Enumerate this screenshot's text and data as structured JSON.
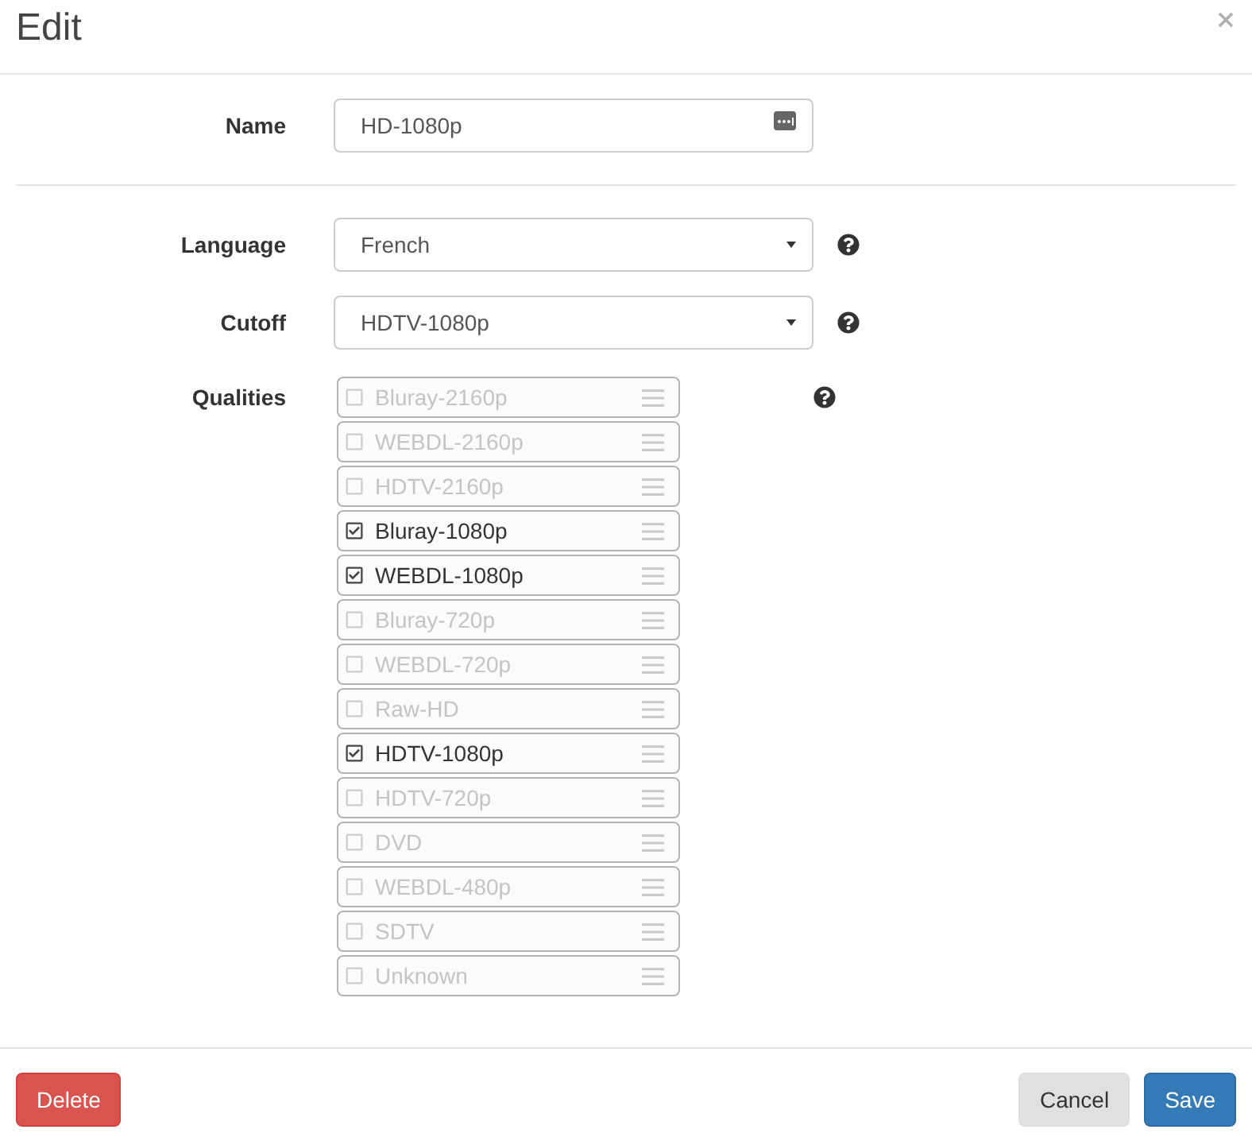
{
  "dialog": {
    "title": "Edit"
  },
  "form": {
    "name": {
      "label": "Name",
      "value": "HD-1080p"
    },
    "language": {
      "label": "Language",
      "value": "French"
    },
    "cutoff": {
      "label": "Cutoff",
      "value": "HDTV-1080p"
    },
    "qualities": {
      "label": "Qualities",
      "items": [
        {
          "label": "Bluray-2160p",
          "checked": false
        },
        {
          "label": "WEBDL-2160p",
          "checked": false
        },
        {
          "label": "HDTV-2160p",
          "checked": false
        },
        {
          "label": "Bluray-1080p",
          "checked": true
        },
        {
          "label": "WEBDL-1080p",
          "checked": true
        },
        {
          "label": "Bluray-720p",
          "checked": false
        },
        {
          "label": "WEBDL-720p",
          "checked": false
        },
        {
          "label": "Raw-HD",
          "checked": false
        },
        {
          "label": "HDTV-1080p",
          "checked": true
        },
        {
          "label": "HDTV-720p",
          "checked": false
        },
        {
          "label": "DVD",
          "checked": false
        },
        {
          "label": "WEBDL-480p",
          "checked": false
        },
        {
          "label": "SDTV",
          "checked": false
        },
        {
          "label": "Unknown",
          "checked": false
        }
      ]
    }
  },
  "footer": {
    "left_buttons": [
      {
        "label": "Delete",
        "kind": "danger"
      }
    ],
    "right_buttons": [
      {
        "label": "Cancel",
        "kind": "default"
      },
      {
        "label": "Save",
        "kind": "primary"
      }
    ]
  }
}
